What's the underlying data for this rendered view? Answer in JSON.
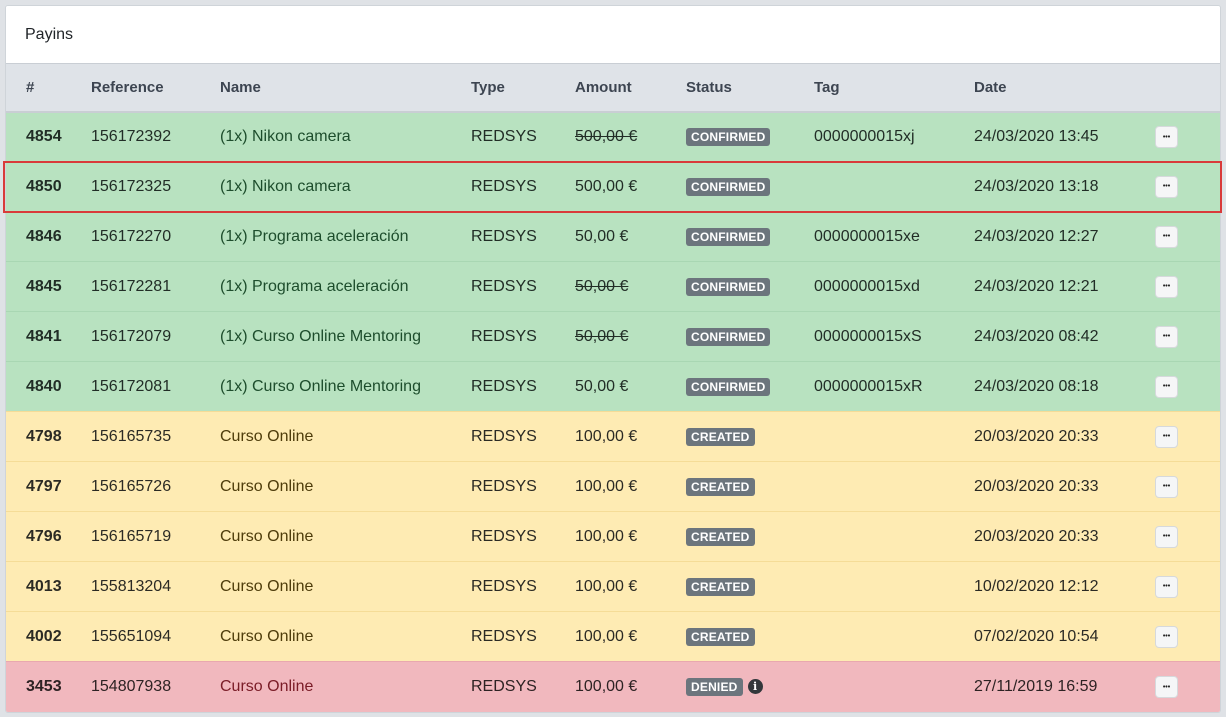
{
  "card": {
    "title": "Payins"
  },
  "columns": {
    "id": "#",
    "reference": "Reference",
    "name": "Name",
    "type": "Type",
    "amount": "Amount",
    "status": "Status",
    "tag": "Tag",
    "date": "Date"
  },
  "colors": {
    "confirmed_row": "#b8e2c0",
    "created_row": "#feebb3",
    "denied_row": "#f1b8be",
    "badge": "#6c757d",
    "selection_outline": "#d93a3a"
  },
  "actions_icon": "more-horizontal-icon",
  "rows": [
    {
      "id": "4854",
      "reference": "156172392",
      "name": "(1x) Nikon camera",
      "type": "REDSYS",
      "amount": "500,00 €",
      "amount_struck": true,
      "status": "CONFIRMED",
      "tag": "0000000015xj",
      "date": "24/03/2020 13:45",
      "row_state": "success",
      "selected": false,
      "info": false
    },
    {
      "id": "4850",
      "reference": "156172325",
      "name": "(1x) Nikon camera",
      "type": "REDSYS",
      "amount": "500,00 €",
      "amount_struck": false,
      "status": "CONFIRMED",
      "tag": "",
      "date": "24/03/2020 13:18",
      "row_state": "success",
      "selected": true,
      "info": false
    },
    {
      "id": "4846",
      "reference": "156172270",
      "name": "(1x) Programa aceleración",
      "type": "REDSYS",
      "amount": "50,00 €",
      "amount_struck": false,
      "status": "CONFIRMED",
      "tag": "0000000015xe",
      "date": "24/03/2020 12:27",
      "row_state": "success",
      "selected": false,
      "info": false
    },
    {
      "id": "4845",
      "reference": "156172281",
      "name": "(1x) Programa aceleración",
      "type": "REDSYS",
      "amount": "50,00 €",
      "amount_struck": true,
      "status": "CONFIRMED",
      "tag": "0000000015xd",
      "date": "24/03/2020 12:21",
      "row_state": "success",
      "selected": false,
      "info": false
    },
    {
      "id": "4841",
      "reference": "156172079",
      "name": "(1x) Curso Online Mentoring",
      "type": "REDSYS",
      "amount": "50,00 €",
      "amount_struck": true,
      "status": "CONFIRMED",
      "tag": "0000000015xS",
      "date": "24/03/2020 08:42",
      "row_state": "success",
      "selected": false,
      "info": false
    },
    {
      "id": "4840",
      "reference": "156172081",
      "name": "(1x) Curso Online Mentoring",
      "type": "REDSYS",
      "amount": "50,00 €",
      "amount_struck": false,
      "status": "CONFIRMED",
      "tag": "0000000015xR",
      "date": "24/03/2020 08:18",
      "row_state": "success",
      "selected": false,
      "info": false
    },
    {
      "id": "4798",
      "reference": "156165735",
      "name": "Curso Online",
      "type": "REDSYS",
      "amount": "100,00 €",
      "amount_struck": false,
      "status": "CREATED",
      "tag": "",
      "date": "20/03/2020 20:33",
      "row_state": "warning",
      "selected": false,
      "info": false
    },
    {
      "id": "4797",
      "reference": "156165726",
      "name": "Curso Online",
      "type": "REDSYS",
      "amount": "100,00 €",
      "amount_struck": false,
      "status": "CREATED",
      "tag": "",
      "date": "20/03/2020 20:33",
      "row_state": "warning",
      "selected": false,
      "info": false
    },
    {
      "id": "4796",
      "reference": "156165719",
      "name": "Curso Online",
      "type": "REDSYS",
      "amount": "100,00 €",
      "amount_struck": false,
      "status": "CREATED",
      "tag": "",
      "date": "20/03/2020 20:33",
      "row_state": "warning",
      "selected": false,
      "info": false
    },
    {
      "id": "4013",
      "reference": "155813204",
      "name": "Curso Online",
      "type": "REDSYS",
      "amount": "100,00 €",
      "amount_struck": false,
      "status": "CREATED",
      "tag": "",
      "date": "10/02/2020 12:12",
      "row_state": "warning",
      "selected": false,
      "info": false
    },
    {
      "id": "4002",
      "reference": "155651094",
      "name": "Curso Online",
      "type": "REDSYS",
      "amount": "100,00 €",
      "amount_struck": false,
      "status": "CREATED",
      "tag": "",
      "date": "07/02/2020 10:54",
      "row_state": "warning",
      "selected": false,
      "info": false
    },
    {
      "id": "3453",
      "reference": "154807938",
      "name": "Curso Online",
      "type": "REDSYS",
      "amount": "100,00 €",
      "amount_struck": false,
      "status": "DENIED",
      "tag": "",
      "date": "27/11/2019 16:59",
      "row_state": "danger",
      "selected": false,
      "info": true
    }
  ]
}
